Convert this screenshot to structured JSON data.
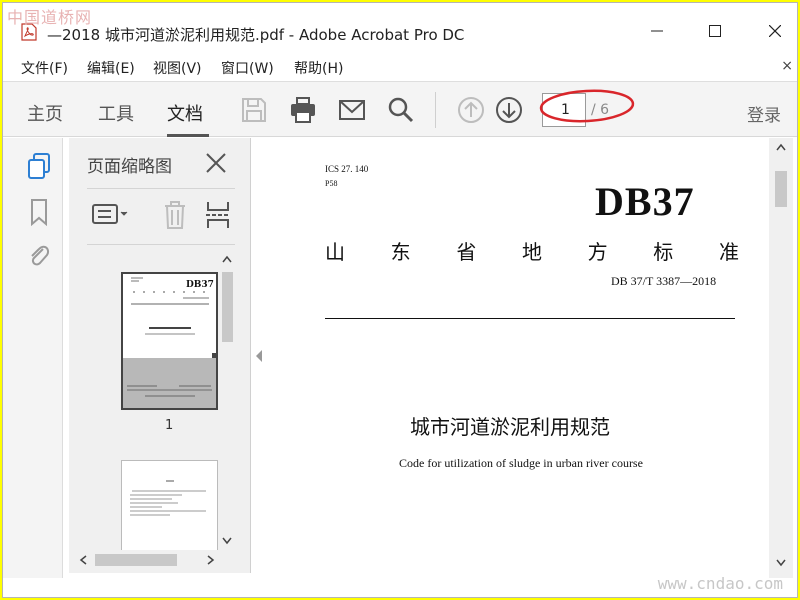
{
  "watermark": {
    "top": "中国道桥网",
    "bottom": "www.cndao.com"
  },
  "window": {
    "title": "—2018 城市河道淤泥利用规范.pdf - Adobe Acrobat Pro DC",
    "app_icon": "pdf-icon"
  },
  "menu": {
    "items": [
      "文件(F)",
      "编辑(E)",
      "视图(V)",
      "窗口(W)",
      "帮助(H)"
    ],
    "close": "×"
  },
  "toolbar": {
    "tabs": [
      "主页",
      "工具",
      "文档"
    ],
    "active_tab": "文档",
    "page_current": "1",
    "page_total": "/ 6",
    "login": "登录",
    "icons": [
      "save-icon",
      "print-icon",
      "email-icon",
      "search-icon",
      "page-up-icon",
      "page-down-icon"
    ]
  },
  "thumbnail_panel": {
    "title": "页面缩略图",
    "page_labels": [
      "1"
    ]
  },
  "document": {
    "ics": "ICS  27. 140",
    "code": "P58",
    "standard": "DB37",
    "province_chars": [
      "山",
      "东",
      "省",
      "地",
      "方",
      "标",
      "准"
    ],
    "number": "DB 37/T  3387—2018",
    "title_cn": "城市河道淤泥利用规范",
    "title_en": "Code for utilization of sludge in urban river course"
  },
  "colors": {
    "accent_blue": "#2d7fd3",
    "annotation_red": "#d9262b"
  }
}
